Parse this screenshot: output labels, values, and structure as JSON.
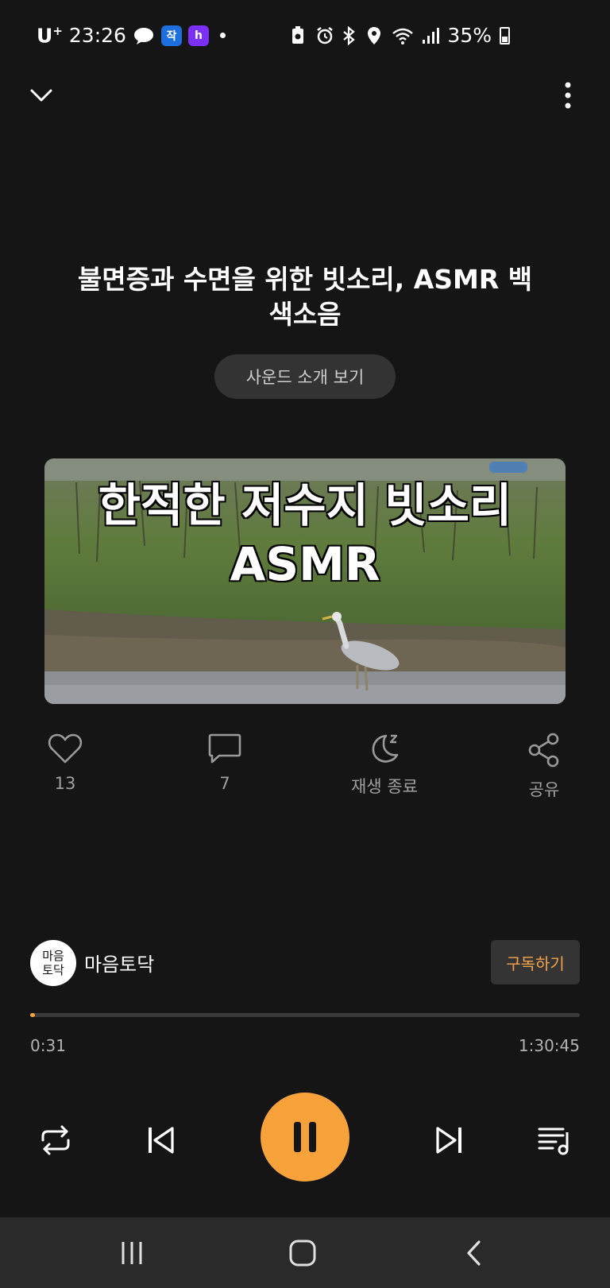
{
  "status_bar": {
    "carrier": "U",
    "carrier_sup": "+",
    "time": "23:26",
    "app_icons": [
      "chat-bubble-icon",
      "jak-app-icon",
      "h-app-icon"
    ],
    "battery_percent": "35%",
    "battery_level": 0.35
  },
  "header": {
    "collapse_icon": "chevron-down-icon",
    "more_icon": "more-vertical-icon"
  },
  "track": {
    "title": "불면증과 수면을 위한 빗소리, ASMR 백색소음",
    "intro_button": "사운드 소개 보기",
    "thumbnail_caption_line1": "한적한 저수지 빗소리",
    "thumbnail_caption_line2": "ASMR"
  },
  "actions": {
    "like_count": "13",
    "comment_count": "7",
    "sleep_timer_label": "재생 종료",
    "share_label": "공유"
  },
  "channel": {
    "avatar_text_line1": "마음",
    "avatar_text_line2": "토닥",
    "name": "마음토닥",
    "subscribe_label": "구독하기"
  },
  "playback": {
    "current_time": "0:31",
    "total_time": "1:30:45",
    "progress_fraction": 0.006,
    "state": "playing"
  },
  "colors": {
    "accent": "#f7a23b",
    "background": "#151515",
    "subscribe_text": "#f5a44b"
  }
}
